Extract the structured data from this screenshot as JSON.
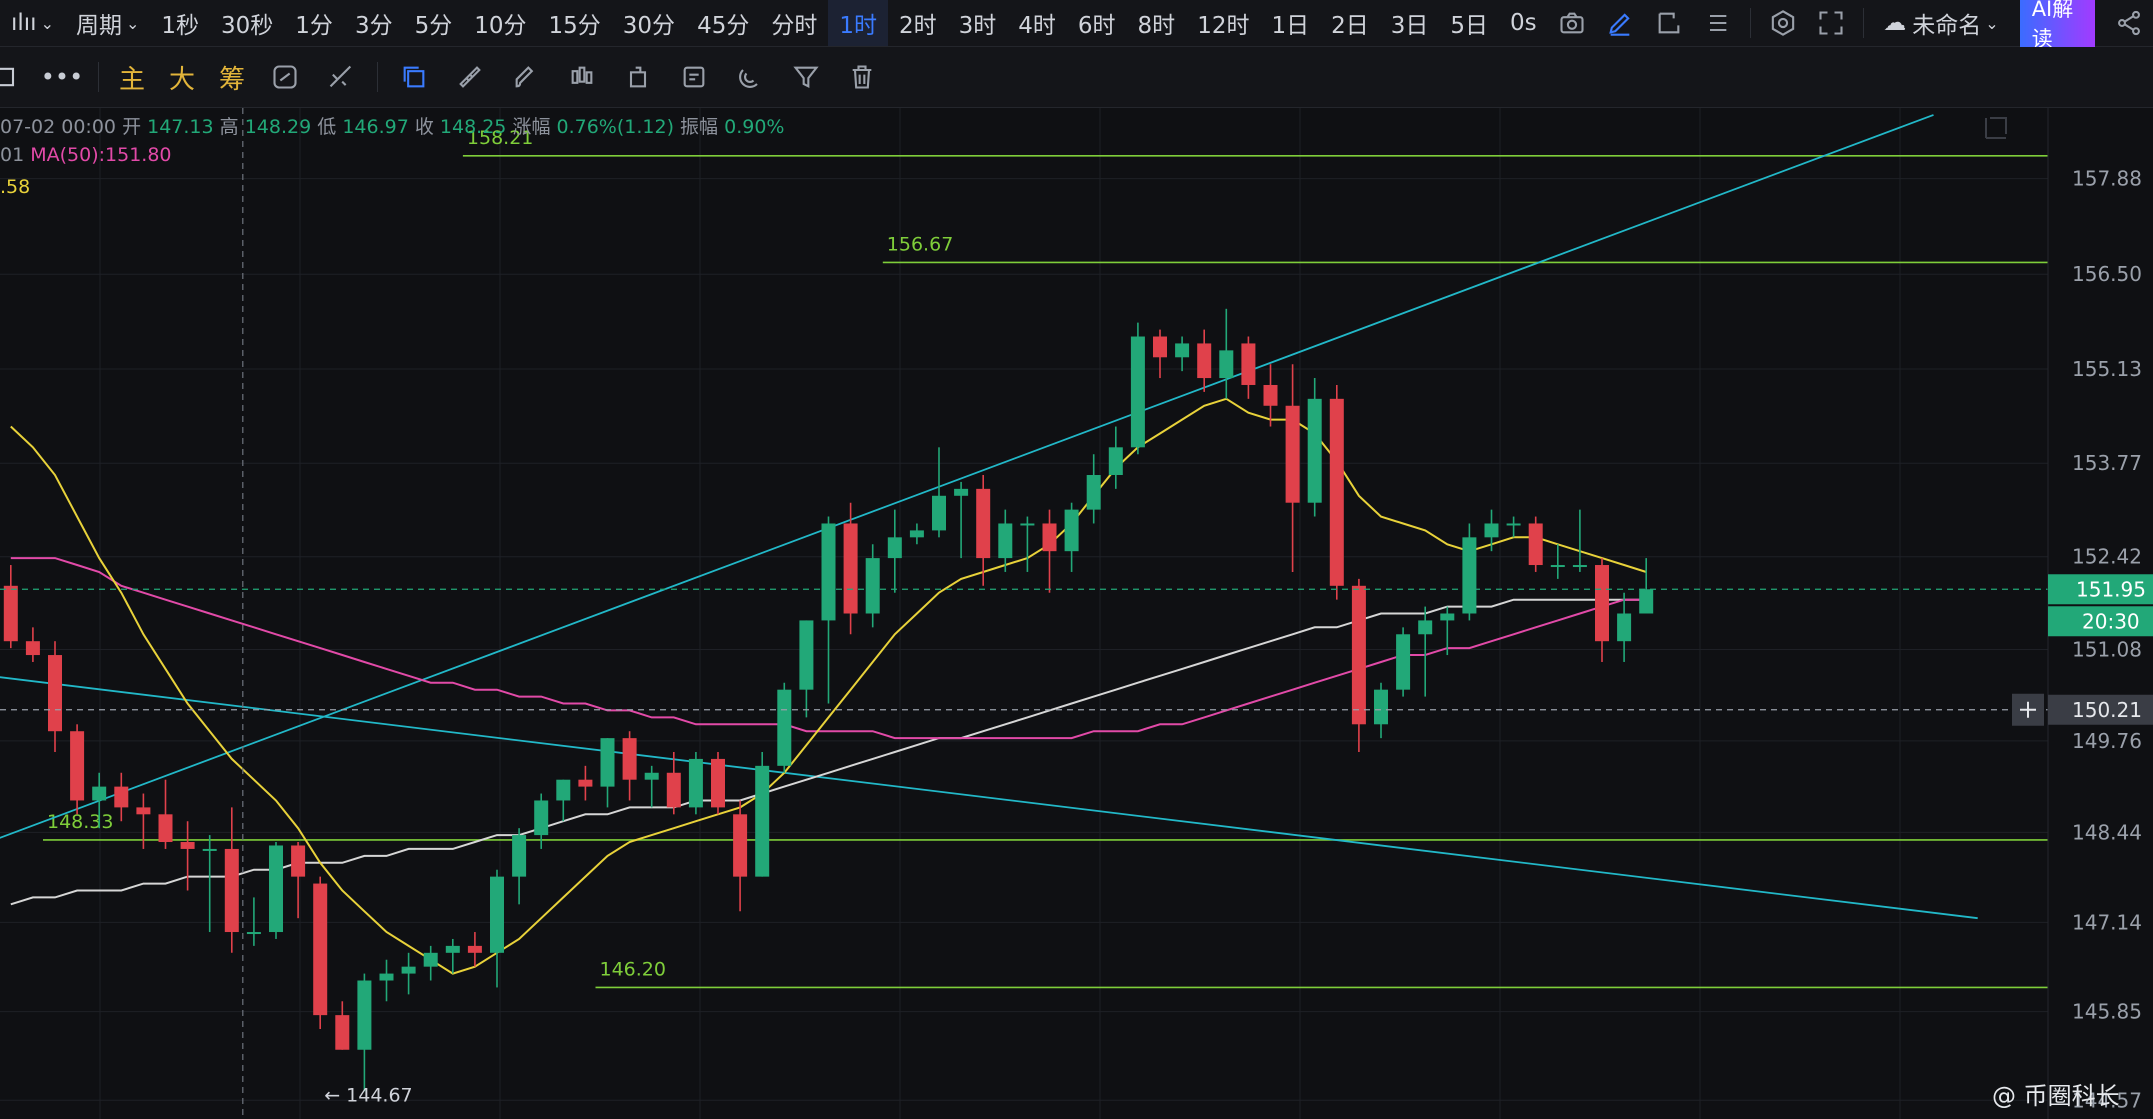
{
  "topbar": {
    "chart_type_label": "ılıı",
    "period_label": "周期",
    "intervals": [
      "1秒",
      "30秒",
      "1分",
      "3分",
      "5分",
      "10分",
      "15分",
      "30分",
      "45分",
      "分时",
      "1时",
      "2时",
      "3时",
      "4时",
      "6时",
      "8时",
      "12时",
      "1日",
      "2日",
      "3日",
      "5日"
    ],
    "active_interval": "1时",
    "latency": "0s",
    "layout_name": "未命名",
    "ai_button": "AI解读"
  },
  "toolbar": {
    "more": "•••",
    "main": "主",
    "big": "大",
    "chips": "筹"
  },
  "ohlc": {
    "date": "07-02 00:00",
    "open_label": "开",
    "open": "147.13",
    "high_label": "高",
    "high": "148.29",
    "low_label": "低",
    "low": "146.97",
    "close_label": "收",
    "close": "148.25",
    "change_label": "涨幅",
    "change": "0.76%(1.12)",
    "amp_label": "振幅",
    "amp": "0.90%"
  },
  "ma50_text": "01  MA(50):151.80",
  "ma20_text": ".58",
  "colors": {
    "up": "#22a878",
    "down": "#e0414b",
    "ma20": "#e8d23a",
    "ma50": "#e24aa8",
    "ma200": "#d6d6d6",
    "trend": "#22b8c8",
    "hline": "#7fce3a",
    "grid": "#1e2026",
    "axis_text": "#9aa0aa"
  },
  "chart_data": {
    "type": "candlestick",
    "ylim": [
      144.3,
      158.9
    ],
    "y_ticks": [
      157.88,
      156.5,
      155.13,
      153.77,
      152.42,
      151.08,
      149.76,
      148.44,
      147.14,
      145.85,
      144.57
    ],
    "candles": [
      {
        "o": 152.0,
        "h": 152.3,
        "l": 151.1,
        "c": 151.2
      },
      {
        "o": 151.2,
        "h": 151.4,
        "l": 150.9,
        "c": 151.0
      },
      {
        "o": 151.0,
        "h": 151.2,
        "l": 149.6,
        "c": 149.9
      },
      {
        "o": 149.9,
        "h": 150.0,
        "l": 148.7,
        "c": 148.9
      },
      {
        "o": 148.9,
        "h": 149.3,
        "l": 148.5,
        "c": 149.1
      },
      {
        "o": 149.1,
        "h": 149.3,
        "l": 148.6,
        "c": 148.8
      },
      {
        "o": 148.8,
        "h": 149.0,
        "l": 148.2,
        "c": 148.7
      },
      {
        "o": 148.7,
        "h": 149.2,
        "l": 148.2,
        "c": 148.3
      },
      {
        "o": 148.3,
        "h": 148.6,
        "l": 147.6,
        "c": 148.2
      },
      {
        "o": 148.2,
        "h": 148.4,
        "l": 147.0,
        "c": 148.2
      },
      {
        "o": 148.2,
        "h": 148.8,
        "l": 146.7,
        "c": 147.0
      },
      {
        "o": 147.0,
        "h": 147.5,
        "l": 146.8,
        "c": 147.0
      },
      {
        "o": 147.0,
        "h": 148.3,
        "l": 146.9,
        "c": 148.25
      },
      {
        "o": 148.25,
        "h": 148.3,
        "l": 147.2,
        "c": 147.8
      },
      {
        "o": 147.7,
        "h": 147.8,
        "l": 145.6,
        "c": 145.8
      },
      {
        "o": 145.8,
        "h": 146.0,
        "l": 145.3,
        "c": 145.3
      },
      {
        "o": 145.3,
        "h": 146.4,
        "l": 144.7,
        "c": 146.3
      },
      {
        "o": 146.3,
        "h": 146.6,
        "l": 146.0,
        "c": 146.4
      },
      {
        "o": 146.4,
        "h": 146.7,
        "l": 146.1,
        "c": 146.5
      },
      {
        "o": 146.5,
        "h": 146.8,
        "l": 146.3,
        "c": 146.7
      },
      {
        "o": 146.7,
        "h": 146.9,
        "l": 146.4,
        "c": 146.8
      },
      {
        "o": 146.8,
        "h": 147.0,
        "l": 146.5,
        "c": 146.7
      },
      {
        "o": 146.7,
        "h": 147.9,
        "l": 146.2,
        "c": 147.8
      },
      {
        "o": 147.8,
        "h": 148.5,
        "l": 147.4,
        "c": 148.4
      },
      {
        "o": 148.4,
        "h": 149.0,
        "l": 148.2,
        "c": 148.9
      },
      {
        "o": 148.9,
        "h": 149.2,
        "l": 148.6,
        "c": 149.2
      },
      {
        "o": 149.2,
        "h": 149.4,
        "l": 148.9,
        "c": 149.1
      },
      {
        "o": 149.1,
        "h": 149.8,
        "l": 148.8,
        "c": 149.8
      },
      {
        "o": 149.8,
        "h": 149.9,
        "l": 148.9,
        "c": 149.2
      },
      {
        "o": 149.2,
        "h": 149.4,
        "l": 148.8,
        "c": 149.3
      },
      {
        "o": 149.3,
        "h": 149.6,
        "l": 148.7,
        "c": 148.8
      },
      {
        "o": 148.8,
        "h": 149.6,
        "l": 148.7,
        "c": 149.5
      },
      {
        "o": 149.5,
        "h": 149.6,
        "l": 148.7,
        "c": 148.8
      },
      {
        "o": 148.7,
        "h": 148.9,
        "l": 147.3,
        "c": 147.8
      },
      {
        "o": 147.8,
        "h": 149.6,
        "l": 147.8,
        "c": 149.4
      },
      {
        "o": 149.4,
        "h": 150.6,
        "l": 149.3,
        "c": 150.5
      },
      {
        "o": 150.5,
        "h": 151.5,
        "l": 150.1,
        "c": 151.5
      },
      {
        "o": 151.5,
        "h": 153.0,
        "l": 150.3,
        "c": 152.9
      },
      {
        "o": 152.9,
        "h": 153.2,
        "l": 151.3,
        "c": 151.6
      },
      {
        "o": 151.6,
        "h": 152.6,
        "l": 151.4,
        "c": 152.4
      },
      {
        "o": 152.4,
        "h": 153.1,
        "l": 151.9,
        "c": 152.7
      },
      {
        "o": 152.7,
        "h": 152.9,
        "l": 152.6,
        "c": 152.8
      },
      {
        "o": 152.8,
        "h": 154.0,
        "l": 152.7,
        "c": 153.3
      },
      {
        "o": 153.3,
        "h": 153.5,
        "l": 152.4,
        "c": 153.4
      },
      {
        "o": 153.4,
        "h": 153.6,
        "l": 152.0,
        "c": 152.4
      },
      {
        "o": 152.4,
        "h": 153.1,
        "l": 152.2,
        "c": 152.9
      },
      {
        "o": 152.9,
        "h": 153.0,
        "l": 152.2,
        "c": 152.9
      },
      {
        "o": 152.9,
        "h": 153.1,
        "l": 151.9,
        "c": 152.5
      },
      {
        "o": 152.5,
        "h": 153.2,
        "l": 152.2,
        "c": 153.1
      },
      {
        "o": 153.1,
        "h": 153.9,
        "l": 152.9,
        "c": 153.6
      },
      {
        "o": 153.6,
        "h": 154.3,
        "l": 153.4,
        "c": 154.0
      },
      {
        "o": 154.0,
        "h": 155.8,
        "l": 153.9,
        "c": 155.6
      },
      {
        "o": 155.6,
        "h": 155.7,
        "l": 155.0,
        "c": 155.3
      },
      {
        "o": 155.3,
        "h": 155.6,
        "l": 155.1,
        "c": 155.5
      },
      {
        "o": 155.5,
        "h": 155.7,
        "l": 154.8,
        "c": 155.0
      },
      {
        "o": 155.0,
        "h": 156.0,
        "l": 154.7,
        "c": 155.4
      },
      {
        "o": 155.5,
        "h": 155.6,
        "l": 154.7,
        "c": 154.9
      },
      {
        "o": 154.9,
        "h": 155.2,
        "l": 154.3,
        "c": 154.6
      },
      {
        "o": 154.6,
        "h": 155.2,
        "l": 152.2,
        "c": 153.2
      },
      {
        "o": 153.2,
        "h": 155.0,
        "l": 153.0,
        "c": 154.7
      },
      {
        "o": 154.7,
        "h": 154.9,
        "l": 151.8,
        "c": 152.0
      },
      {
        "o": 152.0,
        "h": 152.1,
        "l": 149.6,
        "c": 150.0
      },
      {
        "o": 150.0,
        "h": 150.6,
        "l": 149.8,
        "c": 150.5
      },
      {
        "o": 150.5,
        "h": 151.4,
        "l": 150.4,
        "c": 151.3
      },
      {
        "o": 151.3,
        "h": 151.7,
        "l": 150.4,
        "c": 151.5
      },
      {
        "o": 151.5,
        "h": 151.7,
        "l": 151.0,
        "c": 151.6
      },
      {
        "o": 151.6,
        "h": 152.9,
        "l": 151.5,
        "c": 152.7
      },
      {
        "o": 152.7,
        "h": 153.1,
        "l": 152.5,
        "c": 152.9
      },
      {
        "o": 152.9,
        "h": 153.0,
        "l": 152.7,
        "c": 152.9
      },
      {
        "o": 152.9,
        "h": 153.0,
        "l": 152.2,
        "c": 152.3
      },
      {
        "o": 152.3,
        "h": 152.6,
        "l": 152.1,
        "c": 152.3
      },
      {
        "o": 152.3,
        "h": 153.1,
        "l": 152.2,
        "c": 152.3
      },
      {
        "o": 152.3,
        "h": 152.4,
        "l": 150.9,
        "c": 151.2
      },
      {
        "o": 151.2,
        "h": 151.9,
        "l": 150.9,
        "c": 151.6
      },
      {
        "o": 151.6,
        "h": 152.4,
        "l": 151.6,
        "c": 151.95
      }
    ],
    "ma20_values": [
      154.3,
      154.0,
      153.6,
      153.0,
      152.4,
      151.9,
      151.3,
      150.8,
      150.3,
      149.9,
      149.5,
      149.2,
      148.9,
      148.5,
      148.0,
      147.6,
      147.3,
      147.0,
      146.8,
      146.6,
      146.4,
      146.5,
      146.7,
      146.9,
      147.2,
      147.5,
      147.8,
      148.1,
      148.3,
      148.4,
      148.5,
      148.6,
      148.7,
      148.8,
      149.0,
      149.3,
      149.7,
      150.1,
      150.5,
      150.9,
      151.3,
      151.6,
      151.9,
      152.1,
      152.2,
      152.3,
      152.4,
      152.6,
      152.9,
      153.3,
      153.7,
      154.0,
      154.2,
      154.4,
      154.6,
      154.7,
      154.5,
      154.4,
      154.4,
      154.2,
      153.8,
      153.3,
      153.0,
      152.9,
      152.8,
      152.6,
      152.5,
      152.6,
      152.7,
      152.7,
      152.6,
      152.5,
      152.4,
      152.3,
      152.2
    ],
    "ma50_values": [
      152.4,
      152.4,
      152.4,
      152.3,
      152.2,
      152.0,
      151.9,
      151.8,
      151.7,
      151.6,
      151.5,
      151.4,
      151.3,
      151.2,
      151.1,
      151.0,
      150.9,
      150.8,
      150.7,
      150.6,
      150.6,
      150.5,
      150.5,
      150.4,
      150.4,
      150.3,
      150.3,
      150.2,
      150.2,
      150.1,
      150.1,
      150.0,
      150.0,
      150.0,
      150.0,
      150.0,
      149.9,
      149.9,
      149.9,
      149.9,
      149.8,
      149.8,
      149.8,
      149.8,
      149.8,
      149.8,
      149.8,
      149.8,
      149.8,
      149.9,
      149.9,
      149.9,
      150.0,
      150.0,
      150.1,
      150.2,
      150.3,
      150.4,
      150.5,
      150.6,
      150.7,
      150.8,
      150.9,
      151.0,
      151.0,
      151.1,
      151.1,
      151.2,
      151.3,
      151.4,
      151.5,
      151.6,
      151.7,
      151.8,
      151.8
    ],
    "ma200_values": [
      147.4,
      147.5,
      147.5,
      147.6,
      147.6,
      147.6,
      147.7,
      147.7,
      147.8,
      147.8,
      147.8,
      147.9,
      147.9,
      148.0,
      148.0,
      148.0,
      148.1,
      148.1,
      148.2,
      148.2,
      148.2,
      148.3,
      148.4,
      148.4,
      148.5,
      148.6,
      148.7,
      148.7,
      148.8,
      148.8,
      148.8,
      148.9,
      148.9,
      148.9,
      149.0,
      149.1,
      149.2,
      149.3,
      149.4,
      149.5,
      149.6,
      149.7,
      149.8,
      149.8,
      149.9,
      150.0,
      150.1,
      150.2,
      150.3,
      150.4,
      150.5,
      150.6,
      150.7,
      150.8,
      150.9,
      151.0,
      151.1,
      151.2,
      151.3,
      151.4,
      151.4,
      151.5,
      151.6,
      151.6,
      151.6,
      151.7,
      151.7,
      151.7,
      151.8,
      151.8,
      151.8,
      151.8,
      151.8,
      151.8,
      151.8
    ],
    "hlines": [
      {
        "price": 158.21,
        "label": "158.21",
        "start_index": 21
      },
      {
        "price": 156.67,
        "label": "156.67",
        "start_index": 40
      },
      {
        "price": 148.33,
        "label": "148.33",
        "start_index": 2
      },
      {
        "price": 146.2,
        "label": "146.20",
        "start_index": 27
      }
    ],
    "trendlines": [
      {
        "from": [
          -1,
          148.3
        ],
        "to": [
          87,
          158.8
        ]
      },
      {
        "from": [
          -1,
          150.7
        ],
        "to": [
          89,
          147.2
        ]
      }
    ],
    "crosshair_index": 10,
    "crosshair_price": 150.21,
    "current_price": 151.95,
    "countdown": "20:30",
    "low_marker": {
      "index": 14,
      "price": 144.67,
      "label": "← 144.67"
    }
  },
  "watermark": "@ 币圈科长"
}
